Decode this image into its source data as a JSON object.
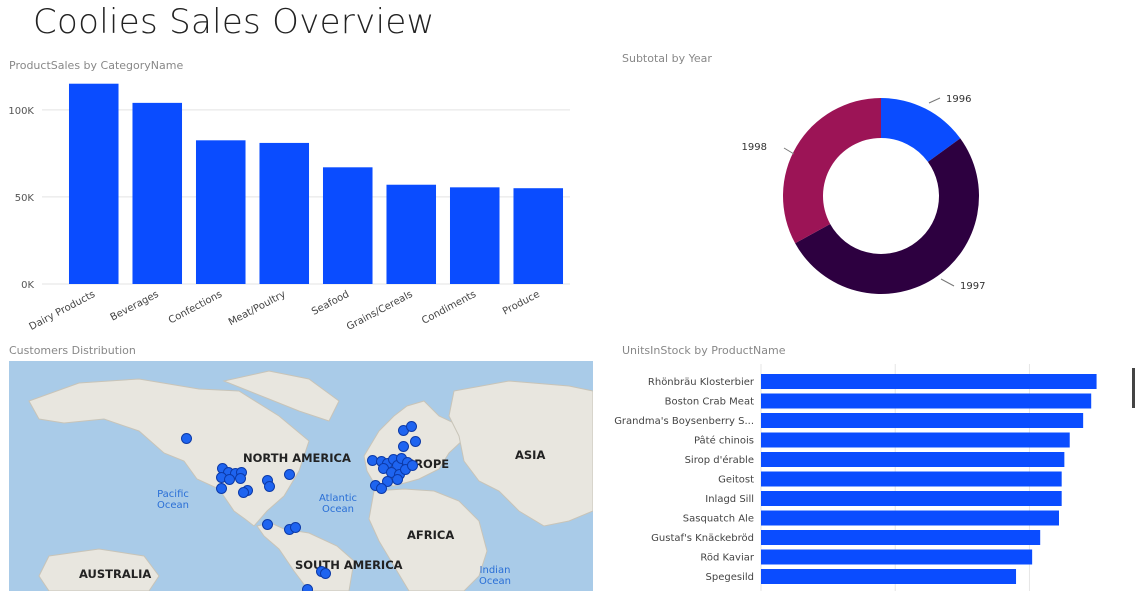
{
  "page_title": "Coolies Sales Overview",
  "colors": {
    "bar": "#0a4cff",
    "donut_1996": "#0a4cff",
    "donut_1997": "#2d0040",
    "donut_1998": "#9c1456",
    "map_water": "#a9cbe8",
    "map_land": "#e8e6df",
    "map_point": "#1e64f0"
  },
  "chart_data": [
    {
      "type": "bar",
      "title": "ProductSales by CategoryName",
      "categories": [
        "Dairy Products",
        "Beverages",
        "Confections",
        "Meat/Poultry",
        "Seafood",
        "Grains/Cereals",
        "Condiments",
        "Produce"
      ],
      "values": [
        115000,
        104000,
        82500,
        81000,
        67000,
        57000,
        55500,
        55000
      ],
      "yticks": [
        "0K",
        "50K",
        "100K"
      ],
      "ylim": [
        0,
        120000
      ],
      "grid": true
    },
    {
      "type": "pie",
      "title": "Subtotal by Year",
      "donut": true,
      "labels": [
        "1996",
        "1997",
        "1998"
      ],
      "values": [
        15,
        52,
        33
      ]
    },
    {
      "type": "bar",
      "orientation": "horizontal",
      "title": "UnitsInStock by ProductName",
      "categories": [
        "Rhönbräu Klosterbier",
        "Boston Crab Meat",
        "Grandma's Boysenberry S...",
        "Pâté chinois",
        "Sirop d'érable",
        "Geitost",
        "Inlagd Sill",
        "Sasquatch Ale",
        "Gustaf's Knäckebröd",
        "Röd Kaviar",
        "Spegesild"
      ],
      "values": [
        125,
        123,
        120,
        115,
        113,
        112,
        112,
        111,
        104,
        101,
        95
      ],
      "xlim": [
        0,
        130
      ],
      "grid": true
    }
  ],
  "map": {
    "title": "Customers Distribution",
    "continents": [
      "NORTH AMERICA",
      "EUROPE",
      "ASIA",
      "AFRICA",
      "SOUTH AMERICA",
      "AUSTRALIA"
    ],
    "oceans": [
      "Pacific Ocean",
      "Atlantic Ocean",
      "Indian Ocean"
    ]
  }
}
